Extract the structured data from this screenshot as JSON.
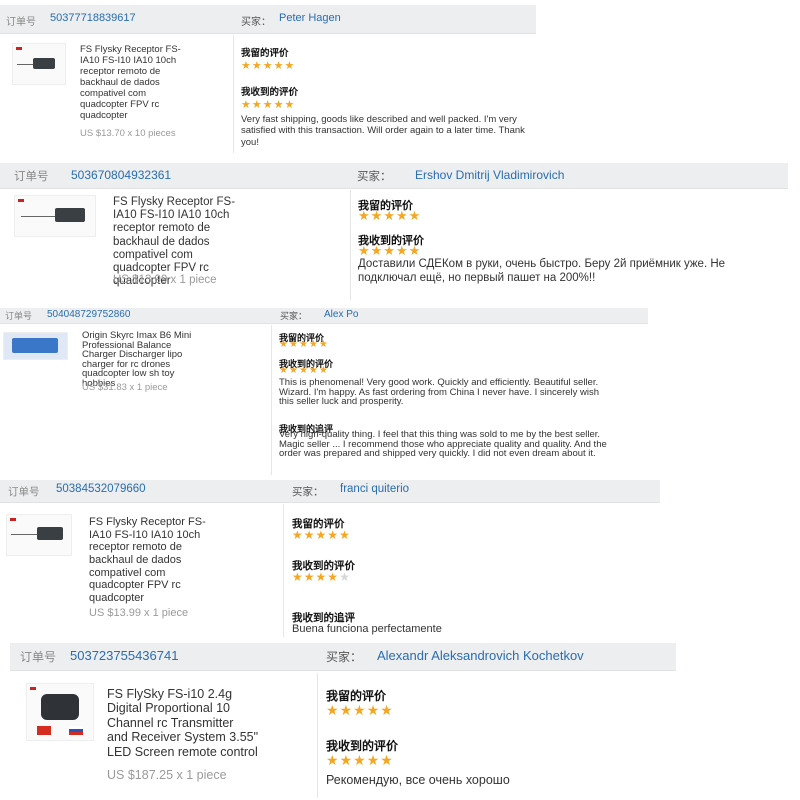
{
  "labels": {
    "order": "订单号",
    "buyer": "买家：",
    "my_review": "我留的评价",
    "received_review": "我收到的评价",
    "received_followup": "我收到的追评"
  },
  "orders": [
    {
      "order_no": "50377718839617",
      "buyer": "Peter Hagen",
      "title": "FS Flysky Receptor FS-\nIA10 FS-I10 IA10 10ch\nreceptor remoto de\nbackhaul de dados\ncompativel com\nquadcopter FPV rc\nquadcopter",
      "price": "US $13.70 x 10 pieces",
      "my_stars": 5,
      "recv_stars": 5,
      "recv_text": "Very fast shipping, goods like described and well packed. I'm very satisfied with this transaction. Will order again to a later time. Thank you!"
    },
    {
      "order_no": "503670804932361",
      "buyer": "Ershov Dmitrij Vladimirovich",
      "title": "FS Flysky Receptor FS-\nIA10 FS-I10 IA10 10ch\nreceptor remoto de\nbackhaul de dados\ncompativel com\nquadcopter FPV rc\nquadcopter",
      "price": "US $13.99 x 1 piece",
      "my_stars": 5,
      "recv_stars": 5,
      "recv_text": "Доставили СДЕКом в руки, очень быстро. Беру 2й приёмник уже. Не подключал ещё, но первый пашет на 200%!!"
    },
    {
      "order_no": "504048729752860",
      "buyer": "Alex Po",
      "title": "Origin Skyrc Imax B6 Mini\nProfessional Balance\nCharger Discharger lipo\ncharger for rc drones\nquadcopter low sh toy\nhobbies",
      "price": "US $31.83 x 1 piece",
      "my_stars": 5,
      "recv_stars": 5,
      "recv_text": "This is phenomenal! Very good work. Quickly and efficiently. Beautiful seller. Wizard. I'm happy. As fast ordering from China I never have. I sincerely wish this seller luck and prosperity.",
      "followup_text": "Very high-quality thing. I feel that this thing was sold to me by the best seller. Magic seller ... I recommend those who appreciate quality and quality. And the order was prepared and shipped very quickly. I did not even dream about it."
    },
    {
      "order_no": "50384532079660",
      "buyer": "franci quiterio",
      "title": "FS Flysky Receptor FS-\nIA10 FS-I10 IA10 10ch\nreceptor remoto de\nbackhaul de dados\ncompativel com\nquadcopter FPV rc\nquadcopter",
      "price": "US $13.99 x 1 piece",
      "my_stars": 5,
      "recv_stars": 4,
      "followup_text": "Buena funciona perfectamente"
    },
    {
      "order_no": "503723755436741",
      "buyer": "Alexandr Aleksandrovich Kochetkov",
      "title": "FS FlySky FS-i10 2.4g\nDigital Proportional 10\nChannel rc Transmitter\nand Receiver System 3.55\"\nLED Screen remote control",
      "price": "US $187.25 x 1 piece",
      "my_stars": 5,
      "recv_stars": 5,
      "recv_text": "Рекомендую, все очень хорошо"
    }
  ],
  "colors": {
    "star_on": "#f5a623",
    "star_off": "#d8d8d8",
    "link": "#2a6db0",
    "header_bg": "#eceef0"
  },
  "icons": {
    "star": "★"
  }
}
